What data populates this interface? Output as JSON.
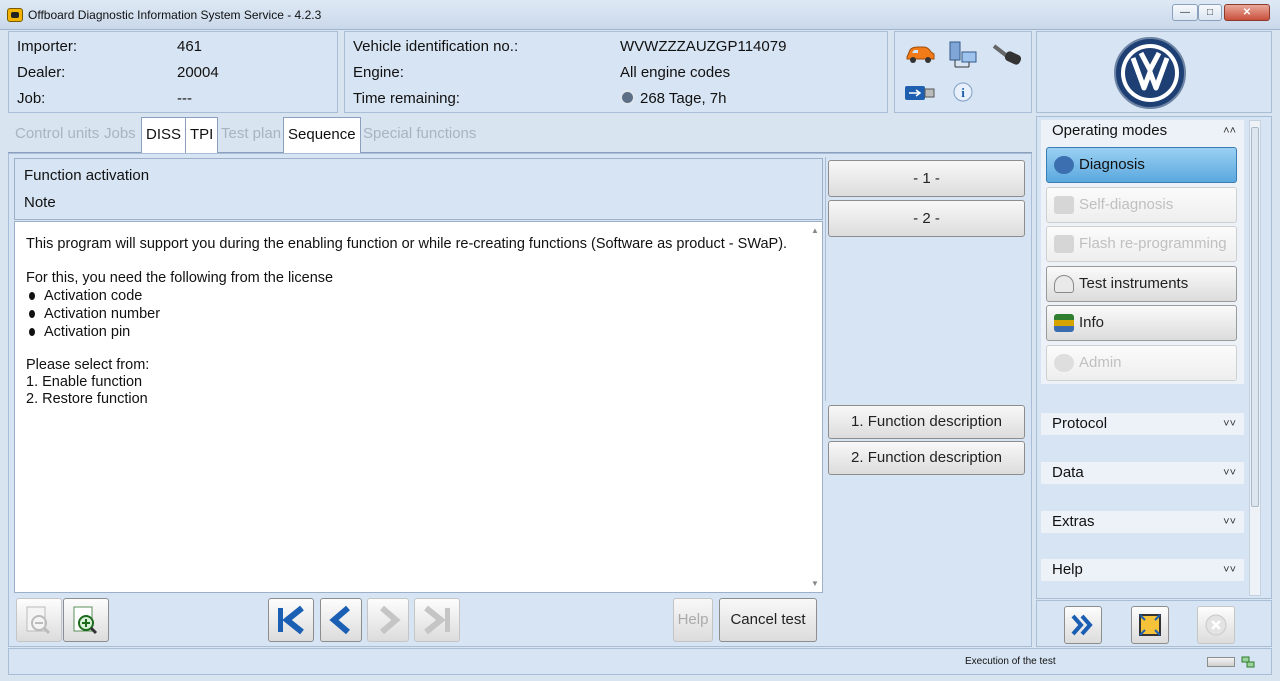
{
  "window": {
    "title": "Offboard Diagnostic Information System Service - 4.2.3",
    "controls": [
      "minimize",
      "maximize",
      "close"
    ]
  },
  "info": {
    "importer_label": "Importer:",
    "importer_value": "461",
    "dealer_label": "Dealer:",
    "dealer_value": "20004",
    "job_label": "Job:",
    "job_value": "---",
    "vin_label": "Vehicle identification no.:",
    "vin_value": "WVWZZZAUZGP114079",
    "engine_label": "Engine:",
    "engine_value": "All engine codes",
    "time_label": "Time remaining:",
    "time_value": "268 Tage, 7h"
  },
  "tabs": [
    {
      "label": "Control units",
      "state": "disabled"
    },
    {
      "label": "Jobs",
      "state": "disabled"
    },
    {
      "label": "DISS",
      "state": "enabled"
    },
    {
      "label": "TPI",
      "state": "enabled"
    },
    {
      "label": "Test plan",
      "state": "disabled"
    },
    {
      "label": "Sequence",
      "state": "selected"
    },
    {
      "label": "Special functions",
      "state": "disabled"
    }
  ],
  "main": {
    "header_title": "Function activation",
    "header_subtitle": "Note",
    "lines": [
      "This program will support you during the enabling function or while re-creating functions (Software as product - SWaP).",
      "For this, you need the following from the license",
      "Activation code",
      "Activation number",
      "Activation pin",
      "Please select from:",
      "1. Enable function",
      "2. Restore function"
    ]
  },
  "side_buttons": {
    "btn1": "- 1 -",
    "btn2": "- 2 -",
    "desc1": "1. Function description",
    "desc2": "2. Function description"
  },
  "bottom": {
    "help": "Help",
    "cancel": "Cancel test"
  },
  "operating_modes": {
    "header": "Operating modes",
    "items": [
      {
        "label": "Diagnosis",
        "state": "active"
      },
      {
        "label": "Self-diagnosis",
        "state": "disabled"
      },
      {
        "label": "Flash re-programming",
        "state": "disabled"
      },
      {
        "label": "Test instruments",
        "state": "enabled"
      },
      {
        "label": "Info",
        "state": "enabled"
      },
      {
        "label": "Admin",
        "state": "disabled"
      }
    ]
  },
  "sections": [
    "Protocol",
    "Data",
    "Extras",
    "Help"
  ],
  "status": {
    "text": "Execution of the test"
  },
  "colors": {
    "panel": "#d7e4f3",
    "active_mode": "#5aa8de",
    "nav_arrow": "#1a5fb4"
  }
}
